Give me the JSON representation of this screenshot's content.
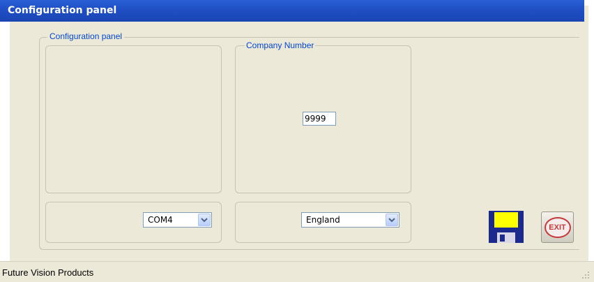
{
  "window": {
    "title": "Configuration panel"
  },
  "frame": {
    "legend": "Configuration panel"
  },
  "company": {
    "legend": "Company Number",
    "value": "9999"
  },
  "port": {
    "selected": "COM4"
  },
  "country": {
    "selected": "England"
  },
  "buttons": {
    "save_icon": "floppy-disk-icon",
    "exit_label": "EXIT"
  },
  "status": {
    "text": "Future Vision Products"
  },
  "colors": {
    "title_bar": "#1f4fc4",
    "legend_text": "#0046d5",
    "panel_bg": "#ece9d8"
  }
}
